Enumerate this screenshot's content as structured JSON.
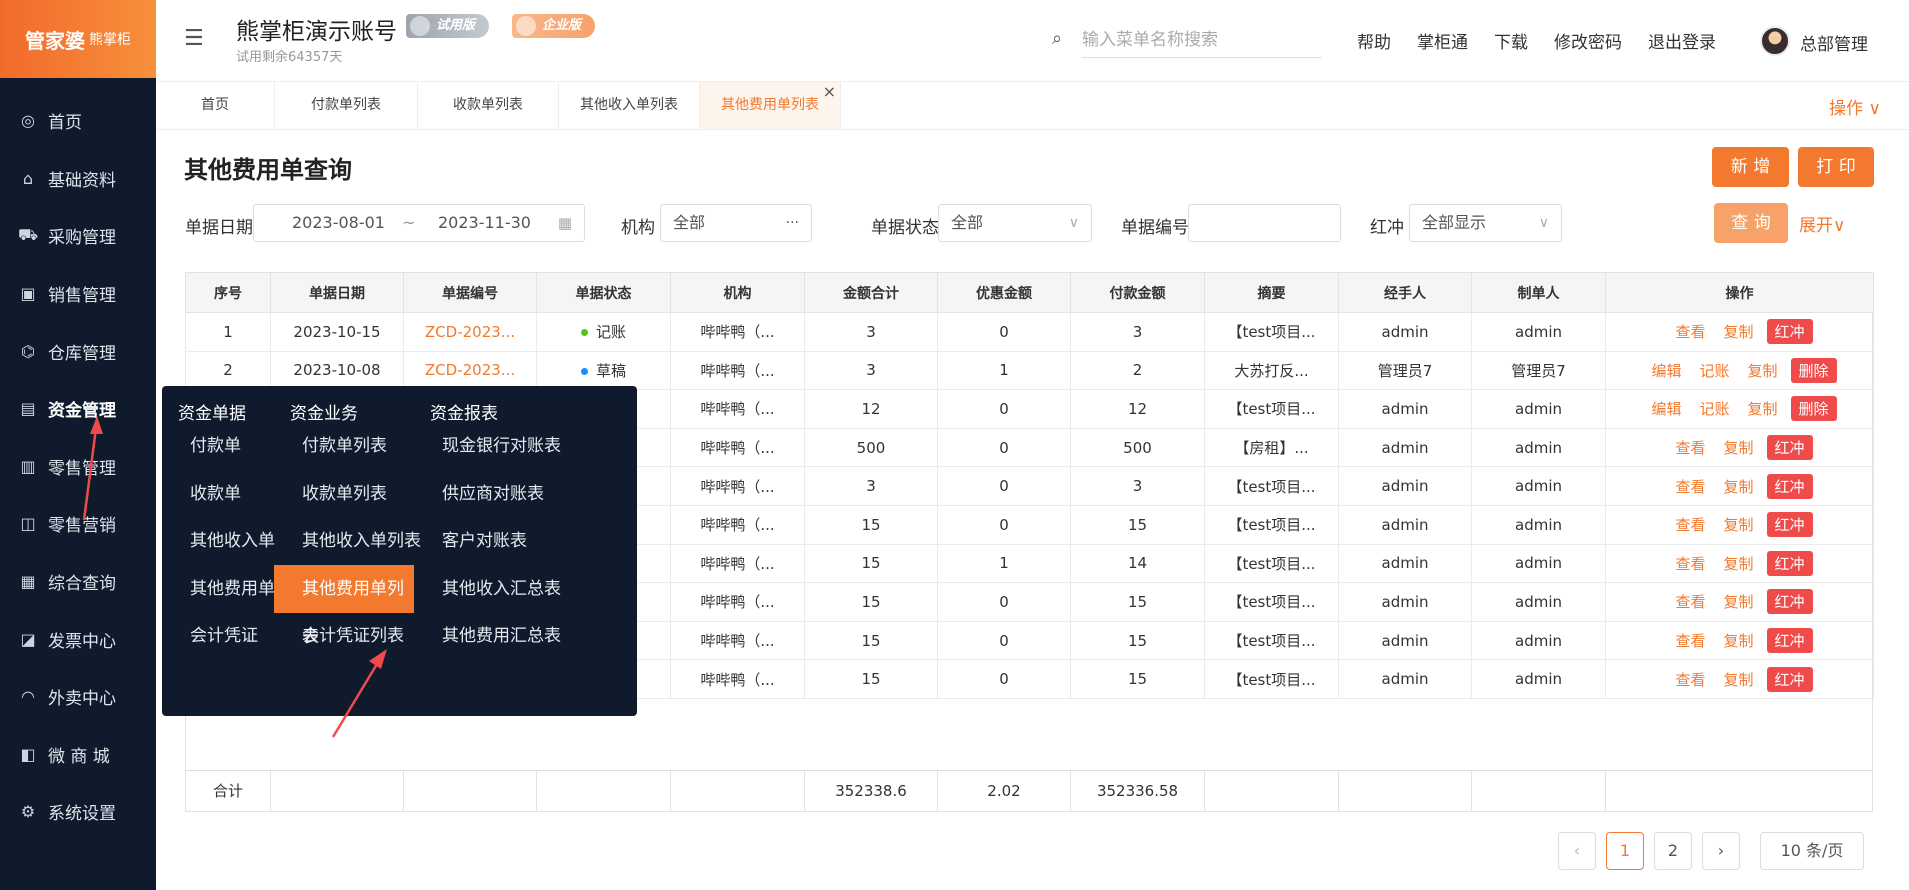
{
  "logo": {
    "main": "管家婆",
    "sub": "熊掌柜"
  },
  "sidebar": {
    "items": [
      {
        "label": "首页",
        "icon": "globe-icon",
        "glyph": "◎"
      },
      {
        "label": "基础资料",
        "icon": "home-icon",
        "glyph": "⌂"
      },
      {
        "label": "采购管理",
        "icon": "cart-icon",
        "glyph": "⛟"
      },
      {
        "label": "销售管理",
        "icon": "sales-icon",
        "glyph": "▣"
      },
      {
        "label": "仓库管理",
        "icon": "warehouse-icon",
        "glyph": "⌬"
      },
      {
        "label": "资金管理",
        "icon": "funds-icon",
        "glyph": "▤"
      },
      {
        "label": "零售管理",
        "icon": "retail-chart-icon",
        "glyph": "▥"
      },
      {
        "label": "零售营销",
        "icon": "gift-icon",
        "glyph": "◫"
      },
      {
        "label": "综合查询",
        "icon": "bar-chart-icon",
        "glyph": "▦"
      },
      {
        "label": "发票中心",
        "icon": "invoice-icon",
        "glyph": "◪"
      },
      {
        "label": "外卖中心",
        "icon": "bell-icon",
        "glyph": "◠"
      },
      {
        "label": "微 商 城",
        "icon": "shop-icon",
        "glyph": "◧"
      },
      {
        "label": "系统设置",
        "icon": "gear-icon",
        "glyph": "⚙"
      }
    ]
  },
  "header": {
    "title": "熊掌柜演示账号",
    "subtitle": "试用剩余64357天",
    "badge_trial": "试用版",
    "badge_enterprise": "企业版",
    "search_placeholder": "输入菜单名称搜索",
    "links": [
      "帮助",
      "掌柜通",
      "下载",
      "修改密码",
      "退出登录"
    ],
    "user": "总部管理"
  },
  "tabs": [
    "首页",
    "付款单列表",
    "收款单列表",
    "其他收入单列表",
    "其他费用单列表"
  ],
  "tabs_close": "×",
  "tabs_ops": "操作 ∨",
  "page": {
    "title": "其他费用单查询",
    "new_button": "新 增",
    "print_button": "打 印",
    "query_button": "查 询",
    "expand": "展开∨"
  },
  "filters": {
    "date_label": "单据日期",
    "date_start": "2023-08-01",
    "date_sep": "~",
    "date_end": "2023-11-30",
    "org_label": "机构",
    "org_value": "全部",
    "org_more": "···",
    "status_label": "单据状态",
    "status_value": "全部",
    "code_label": "单据编号",
    "code_value": "",
    "redflush_label": "红冲",
    "redflush_value": "全部显示"
  },
  "table": {
    "headers": [
      "序号",
      "单据日期",
      "单据编号",
      "单据状态",
      "机构",
      "金额合计",
      "优惠金额",
      "付款金额",
      "摘要",
      "经手人",
      "制单人",
      "操作"
    ],
    "rows": [
      {
        "no": "1",
        "date": "2023-10-15",
        "code": "ZCD-2023...",
        "status": "记账",
        "org": "哔哔鸭（...",
        "total": "3",
        "discount": "0",
        "paid": "3",
        "memo": "【test项目...",
        "handler": "admin",
        "maker": "admin"
      },
      {
        "no": "2",
        "date": "2023-10-08",
        "code": "ZCD-2023...",
        "status": "草稿",
        "org": "哔哔鸭（...",
        "total": "3",
        "discount": "1",
        "paid": "2",
        "memo": "大苏打反...",
        "handler": "管理员7",
        "maker": "管理员7"
      },
      {
        "no": "",
        "date": "",
        "code": "",
        "status": "",
        "org": "哔哔鸭（...",
        "total": "12",
        "discount": "0",
        "paid": "12",
        "memo": "【test项目...",
        "handler": "admin",
        "maker": "admin"
      },
      {
        "no": "",
        "date": "",
        "code": "",
        "status": "",
        "org": "哔哔鸭（...",
        "total": "500",
        "discount": "0",
        "paid": "500",
        "memo": "【房租】...",
        "handler": "admin",
        "maker": "admin"
      },
      {
        "no": "",
        "date": "",
        "code": "",
        "status": "",
        "org": "哔哔鸭（...",
        "total": "3",
        "discount": "0",
        "paid": "3",
        "memo": "【test项目...",
        "handler": "admin",
        "maker": "admin"
      },
      {
        "no": "",
        "date": "",
        "code": "",
        "status": "",
        "org": "哔哔鸭（...",
        "total": "15",
        "discount": "0",
        "paid": "15",
        "memo": "【test项目...",
        "handler": "admin",
        "maker": "admin"
      },
      {
        "no": "",
        "date": "",
        "code": "",
        "status": "",
        "org": "哔哔鸭（...",
        "total": "15",
        "discount": "1",
        "paid": "14",
        "memo": "【test项目...",
        "handler": "admin",
        "maker": "admin"
      },
      {
        "no": "",
        "date": "",
        "code": "",
        "status": "",
        "org": "哔哔鸭（...",
        "total": "15",
        "discount": "0",
        "paid": "15",
        "memo": "【test项目...",
        "handler": "admin",
        "maker": "admin"
      },
      {
        "no": "",
        "date": "",
        "code": "",
        "status": "",
        "org": "哔哔鸭（...",
        "total": "15",
        "discount": "0",
        "paid": "15",
        "memo": "【test项目...",
        "handler": "admin",
        "maker": "admin"
      },
      {
        "no": "",
        "date": "",
        "code": "",
        "status": "",
        "org": "哔哔鸭（...",
        "total": "15",
        "discount": "0",
        "paid": "15",
        "memo": "【test项目...",
        "handler": "admin",
        "maker": "admin"
      }
    ],
    "ops": {
      "view": "查看",
      "copy": "复制",
      "redflush": "红冲",
      "edit": "编辑",
      "post": "记账",
      "delete": "删除"
    },
    "row_ops": [
      [
        "view",
        "copy",
        "redflush"
      ],
      [
        "edit",
        "post",
        "copy",
        "delete"
      ],
      [
        "edit",
        "post",
        "copy",
        "delete"
      ],
      [
        "view",
        "copy",
        "redflush"
      ],
      [
        "view",
        "copy",
        "redflush"
      ],
      [
        "view",
        "copy",
        "redflush"
      ],
      [
        "view",
        "copy",
        "redflush"
      ],
      [
        "view",
        "copy",
        "redflush"
      ],
      [
        "view",
        "copy",
        "redflush"
      ],
      [
        "view",
        "copy",
        "redflush"
      ]
    ],
    "summary": {
      "label": "合计",
      "total": "352338.6",
      "discount": "2.02",
      "paid": "352336.58"
    }
  },
  "pagination": {
    "prev": "‹",
    "pages": [
      "1",
      "2"
    ],
    "next": "›",
    "size": "10 条/页"
  },
  "menu": {
    "columns": [
      {
        "head": "资金单据",
        "items": [
          "付款单",
          "收款单",
          "其他收入单",
          "其他费用单",
          "会计凭证"
        ]
      },
      {
        "head": "资金业务",
        "items": [
          "付款单列表",
          "收款单列表",
          "其他收入单列表",
          "其他费用单列表",
          "会计凭证列表"
        ]
      },
      {
        "head": "资金报表",
        "items": [
          "现金银行对账表",
          "供应商对账表",
          "客户对账表",
          "其他收入汇总表",
          "其他费用汇总表"
        ]
      }
    ]
  },
  "colors": {
    "accent": "#f2792e",
    "danger": "#f04b4b",
    "sidebar": "#0f1b2d",
    "status_posted": "#52c41a",
    "status_draft": "#1890ff"
  }
}
